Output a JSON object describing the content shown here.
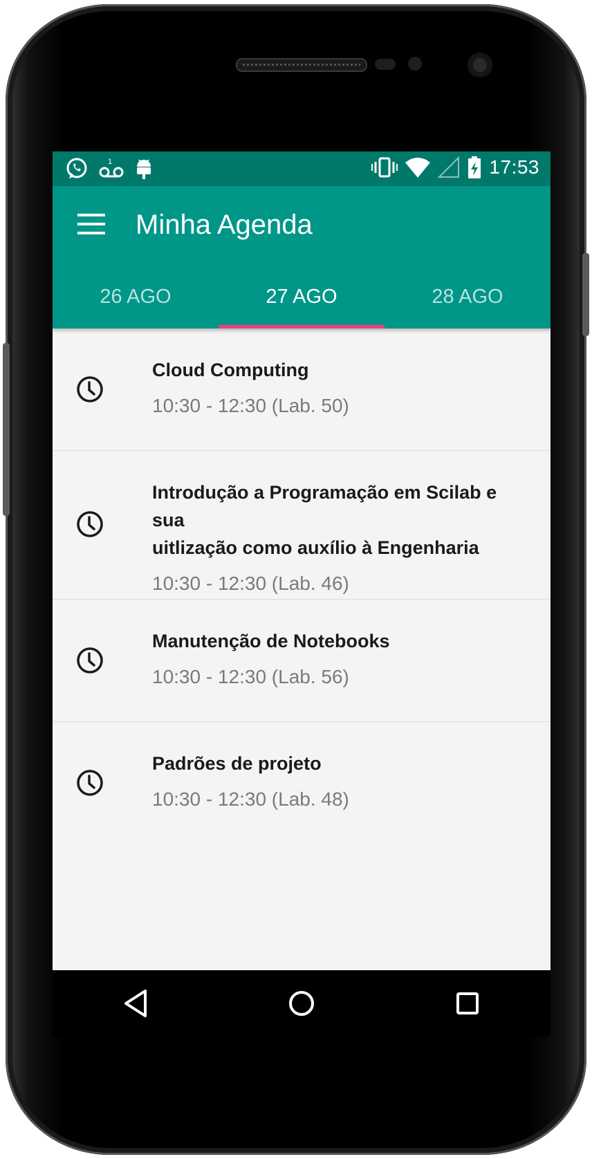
{
  "status_bar": {
    "time": "17:53",
    "left_icons": [
      "whatsapp-icon",
      "voicemail-icon",
      "android-debug-icon"
    ],
    "right_icons": [
      "vibrate-icon",
      "wifi-icon",
      "signal-icon",
      "battery-charging-icon"
    ]
  },
  "app_bar": {
    "title": "Minha Agenda",
    "menu_icon": "menu-icon",
    "background_color": "#009688",
    "status_bar_color": "#00796b",
    "indicator_color": "#ec407a"
  },
  "tabs": [
    {
      "label": "26 AGO",
      "selected": false
    },
    {
      "label": "27 AGO",
      "selected": true
    },
    {
      "label": "28 AGO",
      "selected": false
    }
  ],
  "events": [
    {
      "title_lines": [
        "Cloud Computing"
      ],
      "schedule": "10:30 - 12:30 (Lab. 50)",
      "icon": "clock-icon"
    },
    {
      "title_lines": [
        "Introdução a Programação em Scilab e sua",
        "uitlização como auxílio à Engenharia"
      ],
      "schedule": "10:30 - 12:30 (Lab. 46)",
      "icon": "clock-icon"
    },
    {
      "title_lines": [
        "Manutenção de Notebooks"
      ],
      "schedule": "10:30 - 12:30 (Lab. 56)",
      "icon": "clock-icon"
    },
    {
      "title_lines": [
        "Padrões de projeto"
      ],
      "schedule": "10:30 - 12:30 (Lab. 48)",
      "icon": "clock-icon"
    }
  ],
  "nav_bar": {
    "buttons": [
      "back-icon",
      "home-icon",
      "recents-icon"
    ]
  }
}
